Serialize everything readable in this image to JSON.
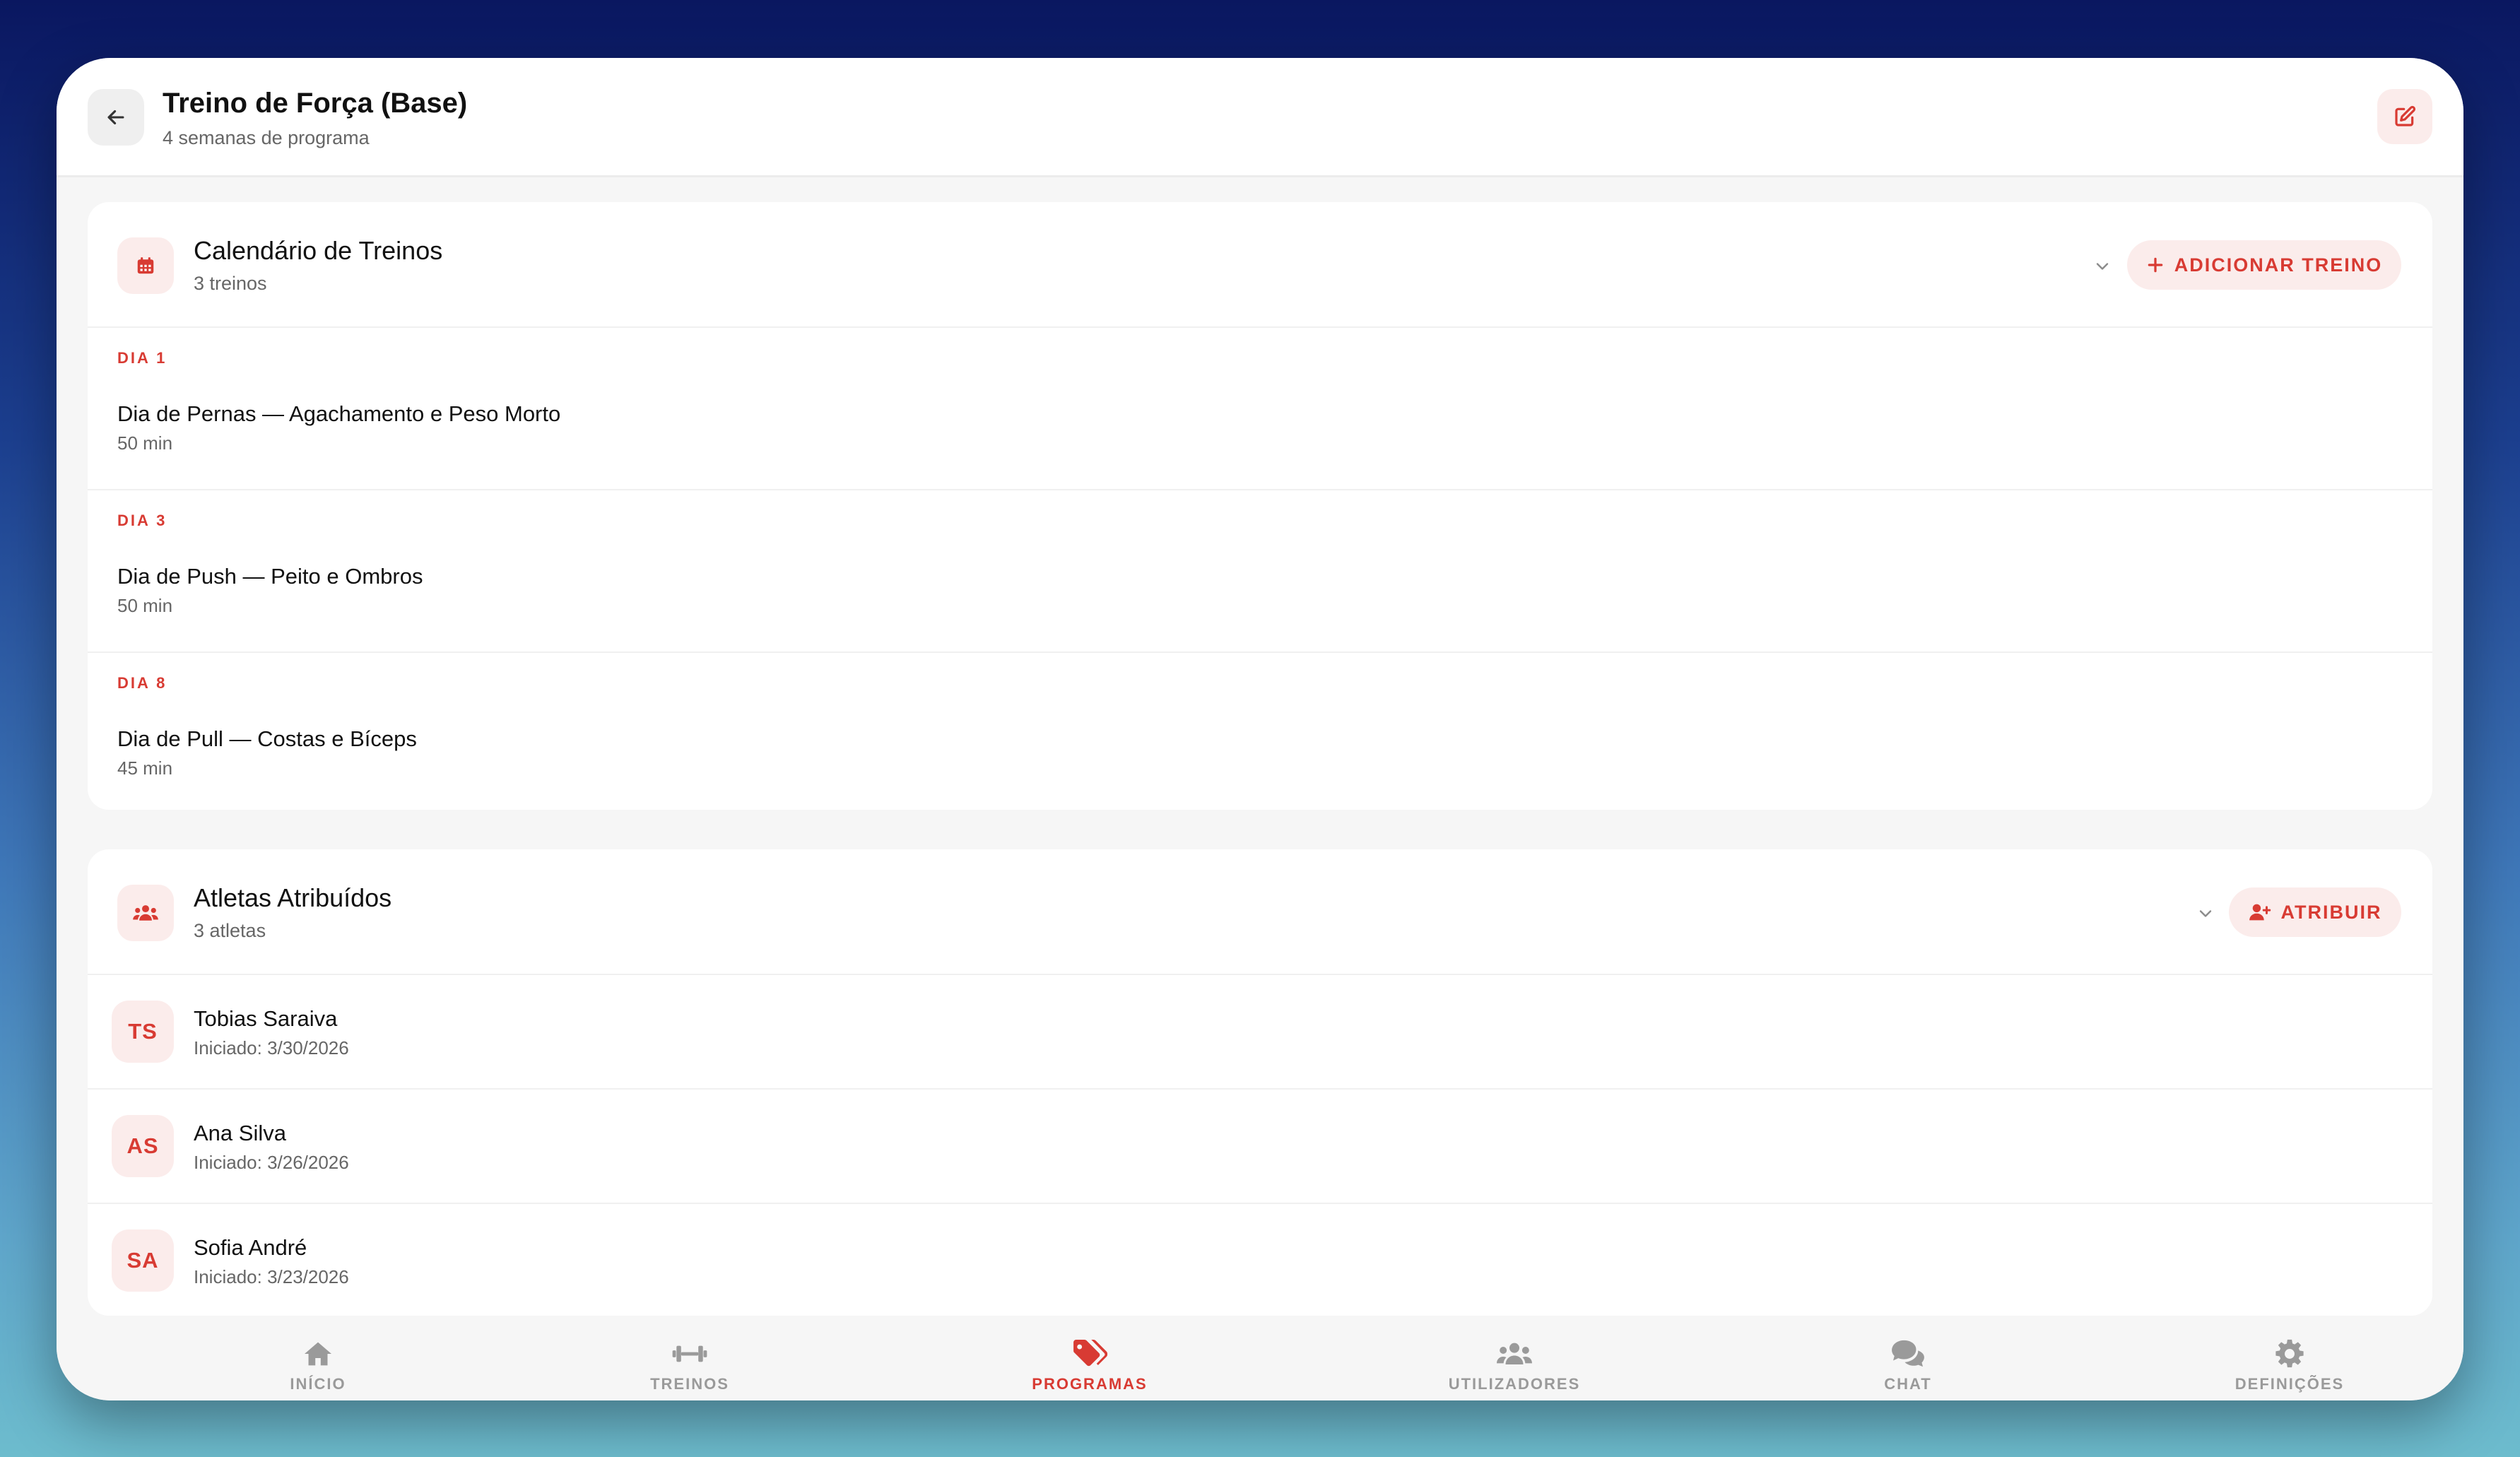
{
  "colors": {
    "accent": "#d83b33",
    "accent_soft": "#fbeceb",
    "muted": "#9a9a9a"
  },
  "header": {
    "title": "Treino de Força (Base)",
    "subtitle": "4 semanas de programa",
    "back_icon": "arrow-left-icon",
    "edit_icon": "edit-icon"
  },
  "workouts_card": {
    "icon": "calendar-icon",
    "title": "Calendário de Treinos",
    "subtitle": "3 treinos",
    "add_label": "ADICIONAR TREINO",
    "items": [
      {
        "day": "DIA 1",
        "name": "Dia de Pernas — Agachamento e Peso Morto",
        "duration": "50 min"
      },
      {
        "day": "DIA 3",
        "name": "Dia de Push — Peito e Ombros",
        "duration": "50 min"
      },
      {
        "day": "DIA 8",
        "name": "Dia de Pull — Costas e Bíceps",
        "duration": "45 min"
      }
    ]
  },
  "athletes_card": {
    "icon": "users-icon",
    "title": "Atletas Atribuídos",
    "subtitle": "3 atletas",
    "assign_label": "ATRIBUIR",
    "items": [
      {
        "initials": "TS",
        "name": "Tobias Saraiva",
        "started": "Iniciado: 3/30/2026"
      },
      {
        "initials": "AS",
        "name": "Ana Silva",
        "started": "Iniciado: 3/26/2026"
      },
      {
        "initials": "SA",
        "name": "Sofia André",
        "started": "Iniciado: 3/23/2026"
      }
    ]
  },
  "bottom_nav": {
    "active": "PROGRAMAS",
    "items": [
      {
        "label": "INÍCIO",
        "icon": "home-icon"
      },
      {
        "label": "TREINOS",
        "icon": "dumbbell-icon"
      },
      {
        "label": "PROGRAMAS",
        "icon": "tags-icon"
      },
      {
        "label": "UTILIZADORES",
        "icon": "users-icon"
      },
      {
        "label": "CHAT",
        "icon": "chat-icon"
      },
      {
        "label": "DEFINIÇÕES",
        "icon": "gear-icon"
      }
    ]
  }
}
